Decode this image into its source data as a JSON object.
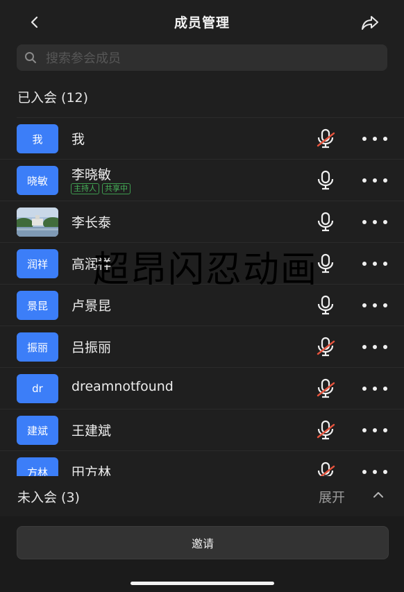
{
  "header": {
    "title": "成员管理",
    "back_icon": "chevron-left-icon",
    "share_icon": "share-icon"
  },
  "search": {
    "placeholder": "搜索参会成员",
    "icon": "search-icon"
  },
  "joined": {
    "title": "已入会 (12)",
    "members": [
      {
        "avatar": "我",
        "name": "我",
        "mic": "muted",
        "tags": []
      },
      {
        "avatar": "晓敏",
        "name": "李晓敏",
        "mic": "on",
        "tags": [
          "主持人",
          "共享中"
        ]
      },
      {
        "avatar": "",
        "name": "李长泰",
        "mic": "on",
        "tags": [],
        "avatar_type": "photo"
      },
      {
        "avatar": "润祥",
        "name": "高润祥",
        "mic": "on",
        "tags": []
      },
      {
        "avatar": "景昆",
        "name": "卢景昆",
        "mic": "on",
        "tags": []
      },
      {
        "avatar": "振丽",
        "name": "吕振丽",
        "mic": "muted",
        "tags": []
      },
      {
        "avatar": "dr",
        "name": "dreamnotfound",
        "mic": "muted",
        "tags": []
      },
      {
        "avatar": "建斌",
        "name": "王建斌",
        "mic": "muted",
        "tags": []
      },
      {
        "avatar": "方林",
        "name": "田方林",
        "mic": "muted",
        "tags": []
      }
    ]
  },
  "watermark": "超昂闪忍动画",
  "not_joined": {
    "title": "未入会 (3)",
    "expand_label": "展开",
    "chevron_icon": "chevron-up-icon"
  },
  "footer": {
    "invite_label": "邀请"
  },
  "colors": {
    "background": "#1f1f1f",
    "avatar": "#3c7ef8",
    "muted": "#e5533d",
    "tag": "#47b35a"
  }
}
